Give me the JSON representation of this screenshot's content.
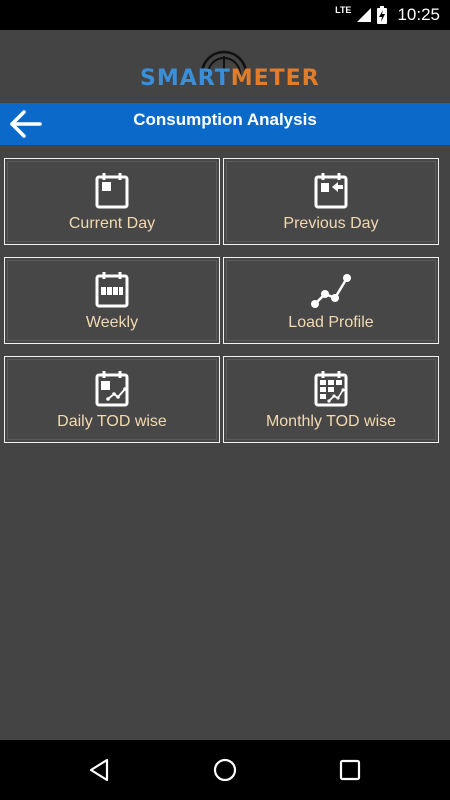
{
  "status_bar": {
    "network": "LTE",
    "time": "10:25"
  },
  "logo": {
    "part1": "SMART",
    "part2": "METER"
  },
  "header": {
    "title": "Consumption Analysis"
  },
  "tiles": [
    {
      "label": "Current Day",
      "icon": "current-day-calendar-icon"
    },
    {
      "label": "Previous Day",
      "icon": "previous-day-calendar-icon"
    },
    {
      "label": "Weekly",
      "icon": "weekly-calendar-icon"
    },
    {
      "label": "Load Profile",
      "icon": "load-profile-graph-icon"
    },
    {
      "label": "Daily TOD wise",
      "icon": "daily-tod-calendar-icon"
    },
    {
      "label": "Monthly TOD wise",
      "icon": "monthly-tod-calendar-icon"
    }
  ],
  "colors": {
    "app_bar": "#0b6ac9",
    "background": "#444444",
    "tile_label": "#f3d9b0",
    "logo_smart": "#3b8fd8",
    "logo_meter": "#e07d2a"
  }
}
